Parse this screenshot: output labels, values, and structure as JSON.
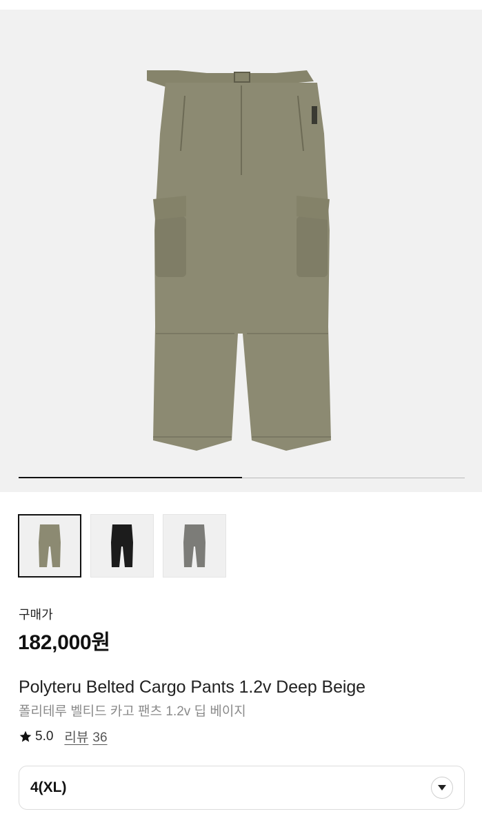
{
  "gallery": {
    "progress_fraction": 0.5,
    "colors": {
      "background": "#f1f1f1",
      "pants": "#8c8a72"
    }
  },
  "thumbnails": [
    {
      "name": "Deep Beige",
      "color": "#8c8a72",
      "selected": true
    },
    {
      "name": "Black",
      "color": "#1c1c1c",
      "selected": false
    },
    {
      "name": "Gray",
      "color": "#7c7c78",
      "selected": false
    }
  ],
  "product": {
    "price_label": "구매가",
    "price": "182,000원",
    "title_en": "Polyteru Belted Cargo Pants 1.2v Deep Beige",
    "title_ko": "폴리테루 벨티드 카고 팬츠 1.2v 딥 베이지"
  },
  "rating": {
    "score": "5.0",
    "review_label": "리뷰",
    "review_count": "36"
  },
  "size_select": {
    "selected": "4(XL)",
    "icon": "chevron-down-icon"
  }
}
